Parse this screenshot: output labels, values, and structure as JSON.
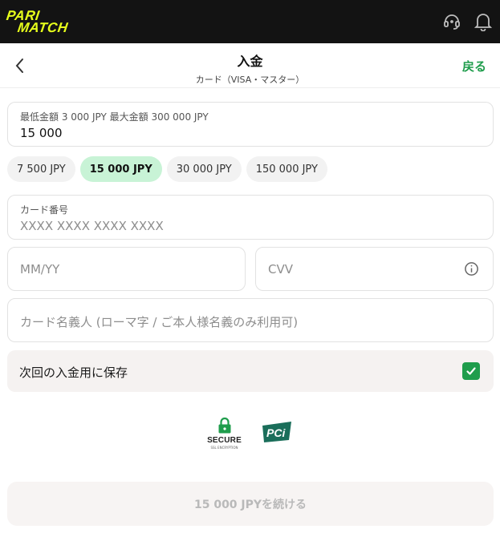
{
  "brand": {
    "line1": "PARI",
    "line2": "MATCH",
    "color": "#e7ff1b"
  },
  "topbar": {
    "icons": [
      "support-agent-icon",
      "bell-icon"
    ]
  },
  "header": {
    "title": "入金",
    "subtitle": "カード（VISA・マスター）",
    "back_label": "戻る"
  },
  "amount": {
    "label": "最低金額 3 000 JPY 最大金額 300 000 JPY",
    "value": "15 000"
  },
  "presets": [
    {
      "label": "7 500 JPY",
      "selected": false
    },
    {
      "label": "15 000 JPY",
      "selected": true
    },
    {
      "label": "30 000 JPY",
      "selected": false
    },
    {
      "label": "150 000 JPY",
      "selected": false
    }
  ],
  "card": {
    "label": "カード番号",
    "placeholder": "XXXX XXXX XXXX XXXX"
  },
  "expiry": {
    "placeholder": "MM/YY"
  },
  "cvv": {
    "placeholder": "CVV"
  },
  "holder": {
    "placeholder": "カード名義人 (ローマ字 / ご本人様名義のみ利用可)"
  },
  "save": {
    "label": "次回の入金用に保存",
    "checked": true
  },
  "badges": {
    "secure": "SECURE",
    "secure_sub": "SSL ENCRYPTION",
    "pci": "PCI"
  },
  "cta": {
    "label": "15 000 JPYを続ける"
  },
  "colors": {
    "accent": "#1f9d4c",
    "chip_active": "#c8f3d6",
    "topbar": "#131313"
  }
}
